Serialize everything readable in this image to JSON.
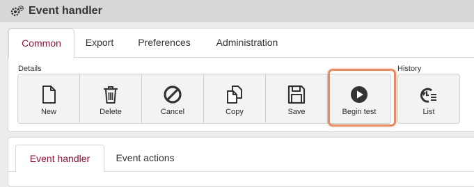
{
  "window": {
    "title": "Event handler"
  },
  "tabs": [
    {
      "label": "Common",
      "active": true
    },
    {
      "label": "Export",
      "active": false
    },
    {
      "label": "Preferences",
      "active": false
    },
    {
      "label": "Administration",
      "active": false
    }
  ],
  "groups": {
    "details": "Details",
    "history": "History"
  },
  "toolbar": {
    "new": "New",
    "delete": "Delete",
    "cancel": "Cancel",
    "copy": "Copy",
    "save": "Save",
    "begin_test": "Begin test",
    "list": "List"
  },
  "subtabs": [
    {
      "label": "Event handler",
      "active": true
    },
    {
      "label": "Event actions",
      "active": false
    }
  ],
  "colors": {
    "accent": "#8a1538",
    "highlight": "#e58a63"
  }
}
